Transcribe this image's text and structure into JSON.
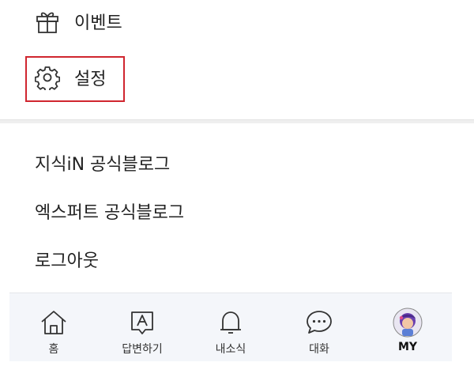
{
  "menu": {
    "event_label": "이벤트",
    "settings_label": "설정"
  },
  "links": [
    "지식iN 공식블로그",
    "엑스퍼트 공식블로그",
    "로그아웃"
  ],
  "tabbar": {
    "tabs": [
      {
        "label": "홈",
        "icon": "home-icon"
      },
      {
        "label": "답변하기",
        "icon": "answer-icon"
      },
      {
        "label": "내소식",
        "icon": "bell-icon"
      },
      {
        "label": "대화",
        "icon": "chat-icon"
      },
      {
        "label": "MY",
        "icon": "avatar",
        "active": true
      }
    ]
  },
  "colors": {
    "highlight_border": "#d0262f",
    "tabbar_bg": "#f4f6fa"
  }
}
